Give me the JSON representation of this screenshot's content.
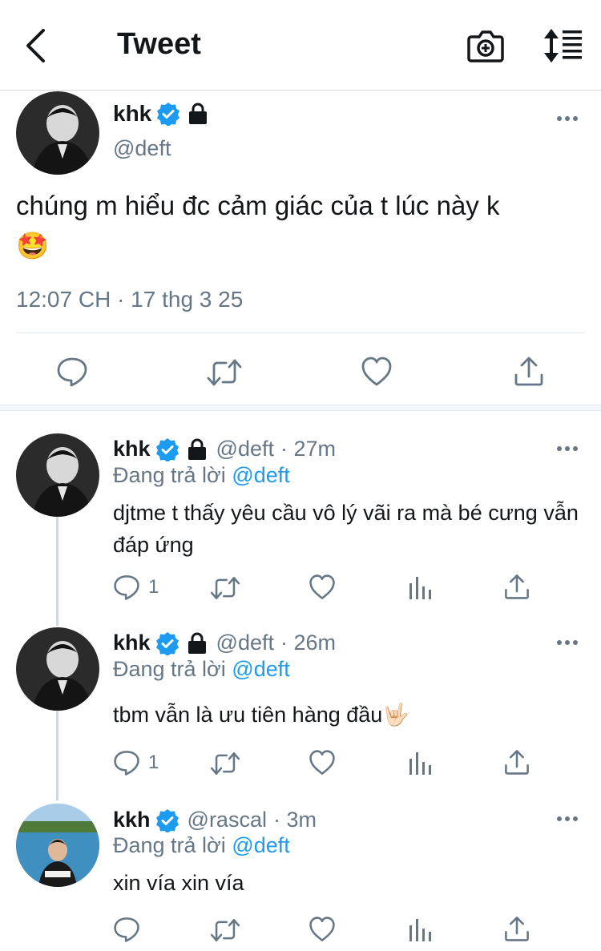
{
  "header": {
    "title": "Tweet"
  },
  "main_tweet": {
    "name": "khk",
    "handle": "@deft",
    "text": "chúng m hiểu đc cảm giác của t lúc này k",
    "emoji": "🤩",
    "timestamp": "12:07 CH · 17 thg 3 25"
  },
  "replies": [
    {
      "name": "khk",
      "handle": "@deft",
      "time": "· 27m",
      "replying_label": "Đang trả lời",
      "replying_to": "@deft",
      "text": "djtme t thấy yêu cầu vô lý vãi ra mà bé cưng vẫn đáp ứng",
      "reply_count": "1"
    },
    {
      "name": "khk",
      "handle": "@deft",
      "time": "· 26m",
      "replying_label": "Đang trả lời",
      "replying_to": "@deft",
      "text": "tbm vẫn là ưu tiên hàng đầu",
      "emoji": "🤟🏻",
      "reply_count": "1"
    },
    {
      "name": "kkh",
      "handle": "@rascal",
      "time": "· 3m",
      "replying_label": "Đang trả lời",
      "replying_to": "@deft",
      "text": "xin vía xin vía"
    }
  ],
  "colors": {
    "accent": "#1d9bf0",
    "muted": "#657786",
    "text": "#14171a"
  },
  "icons": [
    "back-arrow-icon",
    "camera-icon",
    "sort-icon",
    "verified-icon",
    "lock-icon",
    "more-icon",
    "reply-icon",
    "retweet-icon",
    "like-icon",
    "share-icon",
    "analytics-icon"
  ]
}
